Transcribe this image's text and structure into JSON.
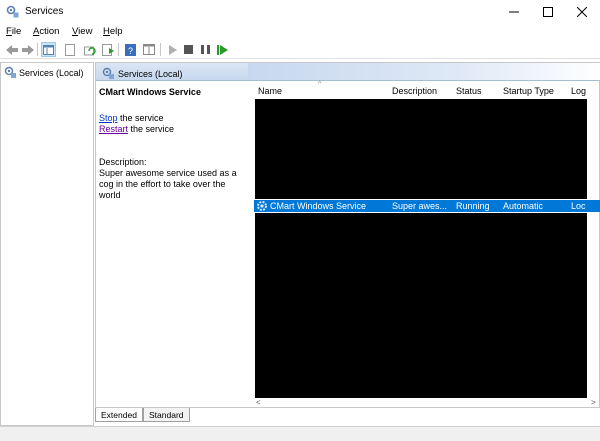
{
  "window": {
    "title": "Services"
  },
  "menu": [
    {
      "label": "File",
      "underline": "F",
      "rest": "ile"
    },
    {
      "label": "Action",
      "underline": "A",
      "rest": "ction"
    },
    {
      "label": "View",
      "underline": "V",
      "rest": "iew"
    },
    {
      "label": "Help",
      "underline": "H",
      "rest": "elp"
    }
  ],
  "tree": {
    "root_label": "Services (Local)"
  },
  "pane": {
    "header_title": "Services (Local)",
    "service_name": "CMart Windows Service",
    "action_stop_link": "Stop",
    "action_stop_rest": " the service",
    "action_restart_link": "Restart",
    "action_restart_rest": " the service",
    "description_label": "Description:",
    "description_text": "Super awesome service used as a cog in the effort to take over the world"
  },
  "table": {
    "columns": [
      "Name",
      "Description",
      "Status",
      "Startup Type",
      "Log"
    ],
    "selected_row": {
      "name": "CMart Windows Service",
      "description": "Super awes...",
      "status": "Running",
      "startup_type": "Automatic",
      "log_on_as": "Loc"
    }
  },
  "tabs": {
    "extended": "Extended",
    "standard": "Standard"
  },
  "colors": {
    "selection": "#0078d7",
    "link": "#0033cc",
    "visited_link": "#6a00a0",
    "header_gradient": "#c7d8ee"
  }
}
